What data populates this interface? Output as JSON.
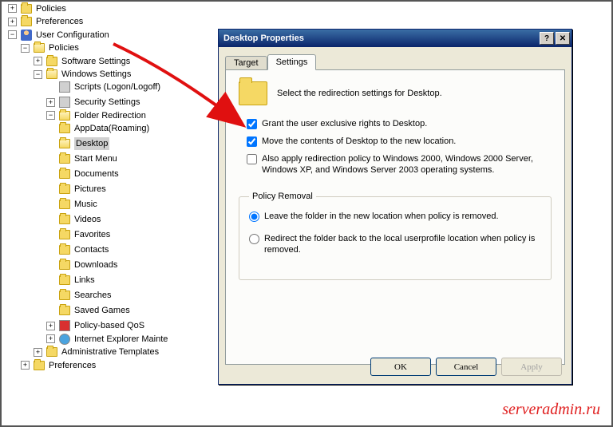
{
  "tree": {
    "policies_top": "Policies",
    "preferences_top": "Preferences",
    "user_config": "User Configuration",
    "policies": "Policies",
    "software_settings": "Software Settings",
    "windows_settings": "Windows Settings",
    "scripts": "Scripts (Logon/Logoff)",
    "security_settings": "Security Settings",
    "folder_redirection": "Folder Redirection",
    "appdata": "AppData(Roaming)",
    "desktop": "Desktop",
    "start_menu": "Start Menu",
    "documents": "Documents",
    "pictures": "Pictures",
    "music": "Music",
    "videos": "Videos",
    "favorites": "Favorites",
    "contacts": "Contacts",
    "downloads": "Downloads",
    "links": "Links",
    "searches": "Searches",
    "saved_games": "Saved Games",
    "policy_qos": "Policy-based QoS",
    "ie_maintenance": "Internet Explorer Maintenance",
    "admin_templates": "Administrative Templates",
    "preferences": "Preferences"
  },
  "dialog": {
    "title": "Desktop Properties",
    "tab_target": "Target",
    "tab_settings": "Settings",
    "description": "Select the redirection settings for Desktop.",
    "check_grant": "Grant the user exclusive rights to Desktop.",
    "check_move": "Move the contents of Desktop to the new location.",
    "check_apply2000": "Also apply redirection policy to Windows 2000, Windows 2000 Server, Windows XP, and Windows Server 2003 operating systems.",
    "fieldset_label": "Policy Removal",
    "radio_leave": "Leave the folder in the new location when policy is removed.",
    "radio_redirect": "Redirect the folder back to the local userprofile location when policy is removed.",
    "btn_ok": "OK",
    "btn_cancel": "Cancel",
    "btn_apply": "Apply"
  },
  "watermark": "serveradmin.ru"
}
